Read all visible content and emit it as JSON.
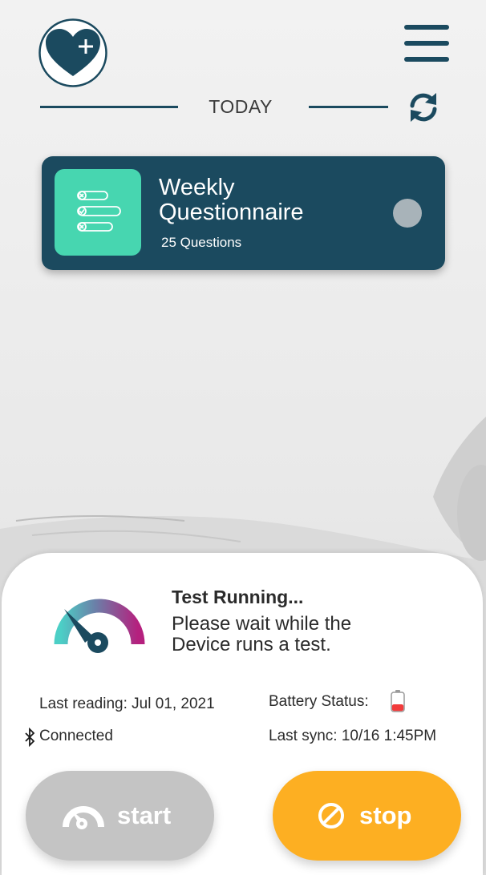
{
  "header": {
    "logo_icon": "heart-plus-icon",
    "menu_icon": "hamburger-menu-icon",
    "day_label": "TODAY",
    "refresh_icon": "sync-icon"
  },
  "card": {
    "icon": "checklist-icon",
    "title": "Weekly Questionnaire",
    "subtitle": "25 Questions",
    "status_dot_color": "#a8b3b9"
  },
  "status": {
    "gauge_icon": "speedometer-icon",
    "title": "Test Running...",
    "message": "Please wait while the Device runs a test."
  },
  "info": {
    "last_reading": "Last reading: Jul 01, 2021",
    "connection": "Connected",
    "connection_icon": "bluetooth-icon",
    "battery_label": "Battery Status:",
    "battery_icon": "battery-low-icon",
    "last_sync": "Last sync: 10/16 1:45PM"
  },
  "actions": {
    "start_label": "start",
    "start_icon": "speedometer-icon",
    "stop_label": "stop",
    "stop_icon": "no-entry-icon"
  },
  "colors": {
    "primary": "#1b4a5f",
    "accent_green": "#47d6b0",
    "stop_orange": "#fdaf22",
    "start_gray": "#c4c4c4",
    "battery_red": "#f23b3b"
  }
}
